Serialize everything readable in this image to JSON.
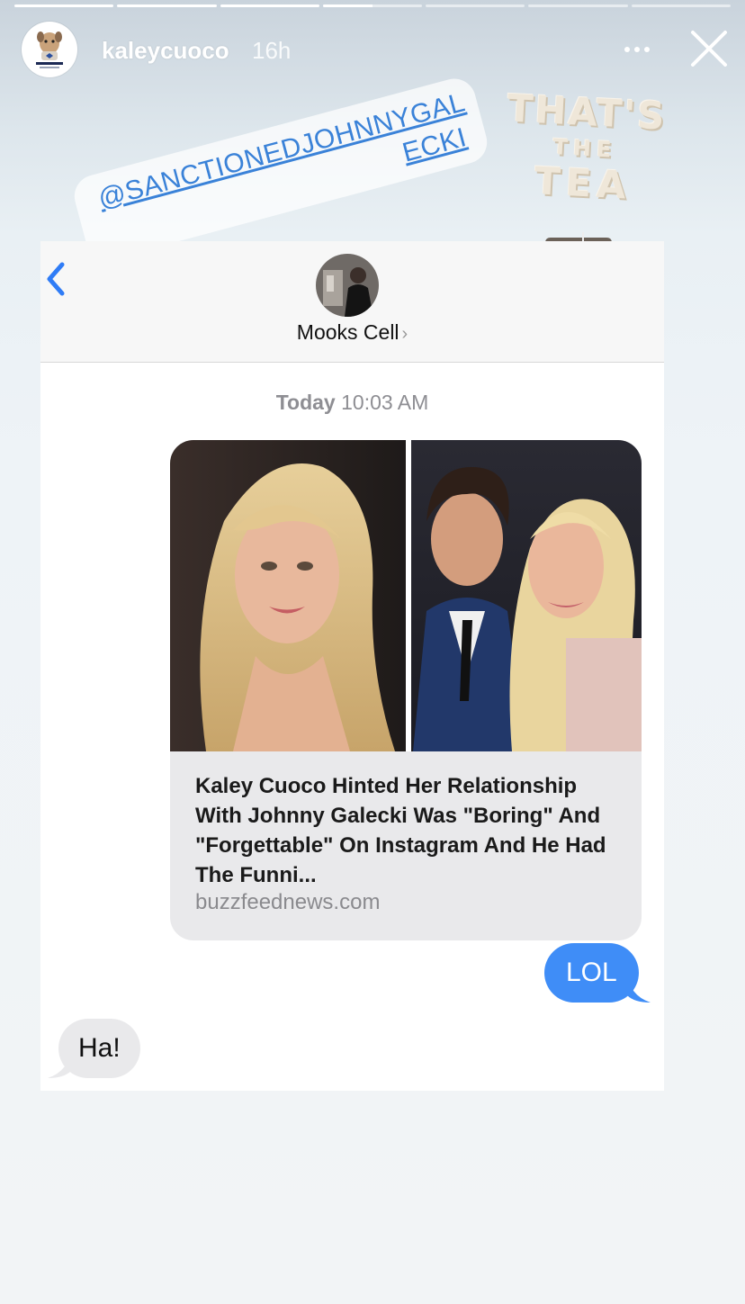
{
  "story": {
    "username": "kaleycuoco",
    "time_ago": "16h",
    "progress_segments": [
      1,
      1,
      1,
      0.5,
      0,
      0,
      0
    ]
  },
  "stickers": {
    "mention": "@SANCTIONEDJOHNNYGALECKI",
    "tea_lines": [
      "THAT'S",
      "THE",
      "TEA"
    ]
  },
  "screenshot": {
    "contact_name": "Mooks Cell",
    "timestamp_day": "Today",
    "timestamp_time": "10:03 AM",
    "link_preview": {
      "title": "Kaley Cuoco Hinted Her Relationship With Johnny Galecki Was \"Boring\" And \"Forgettable\" On Instagram And He Had The Funni...",
      "domain": "buzzfeednews.com"
    },
    "messages": [
      {
        "from": "me",
        "text": "LOL"
      },
      {
        "from": "them",
        "text": "Ha!"
      }
    ]
  },
  "colors": {
    "imessage_blue": "#3f8df7",
    "mention_blue": "#3a82d8",
    "received_gray": "#e9e9eb"
  }
}
